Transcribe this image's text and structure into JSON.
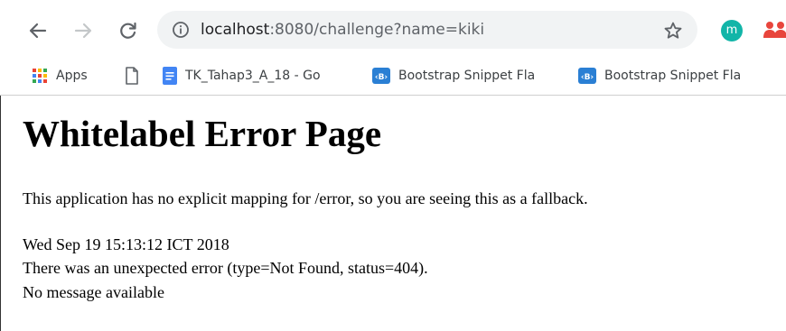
{
  "browser": {
    "url_host": "localhost",
    "url_rest": ":8080/challenge?name=kiki",
    "profile_initial": "m"
  },
  "bookmarks": [
    {
      "label": "Apps",
      "icon": "apps-grid-icon"
    },
    {
      "label": "",
      "icon": "blank-page-icon"
    },
    {
      "label": "TK_Tahap3_A_18 - Go",
      "icon": "google-docs-icon"
    },
    {
      "label": "Bootstrap Snippet Fla",
      "icon": "bootstrap-icon"
    },
    {
      "label": "Bootstrap Snippet Fla",
      "icon": "bootstrap-icon"
    }
  ],
  "page": {
    "title": "Whitelabel Error Page",
    "explanation": "This application has no explicit mapping for /error, so you are seeing this as a fallback.",
    "timestamp": "Wed Sep 19 15:13:12 ICT 2018",
    "error_detail": "There was an unexpected error (type=Not Found, status=404).",
    "message": "No message available"
  }
}
